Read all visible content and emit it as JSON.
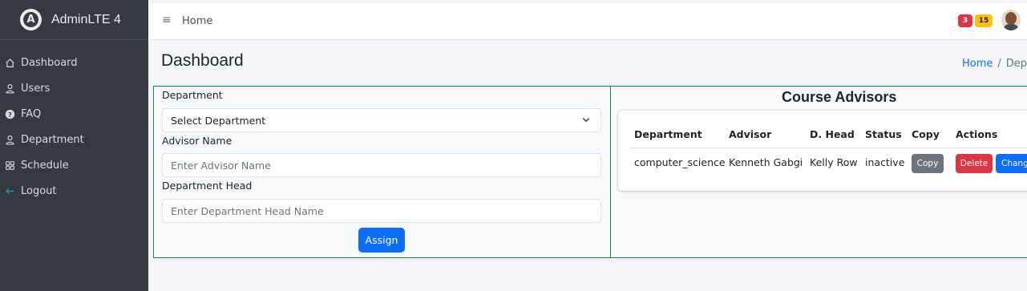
{
  "brand": {
    "name": "AdminLTE 4",
    "logo_letter": "A"
  },
  "sidebar": {
    "items": [
      {
        "label": "Dashboard",
        "icon": "house-icon"
      },
      {
        "label": "Users",
        "icon": "person-icon"
      },
      {
        "label": "FAQ",
        "icon": "question-circle-icon"
      },
      {
        "label": "Department",
        "icon": "person-icon"
      },
      {
        "label": "Schedule",
        "icon": "grid-icon"
      },
      {
        "label": "Logout",
        "icon": "arrow-left-icon"
      }
    ]
  },
  "topbar": {
    "menu_icon": "≡",
    "home_label": "Home",
    "badges": {
      "red": "3",
      "yellow": "15"
    },
    "colors": {
      "red": "#dc3545",
      "yellow": "#ffc107"
    }
  },
  "header": {
    "title": "Dashboard",
    "breadcrumb": {
      "home": "Home",
      "separator": "/",
      "current": "Depa"
    }
  },
  "form": {
    "department_label": "Department",
    "department_select": "Select Department",
    "advisor_label": "Advisor Name",
    "advisor_placeholder": "Enter Advisor Name",
    "head_label": "Department Head",
    "head_placeholder": "Enter Department Head Name",
    "assign_button": "Assign"
  },
  "table": {
    "title": "Course Advisors",
    "columns": [
      "Department",
      "Advisor",
      "D. Head",
      "Status",
      "Copy",
      "Actions"
    ],
    "rows": [
      {
        "department": "computer_science",
        "advisor": "Kenneth Gabgi",
        "head": "Kelly Row",
        "status": "inactive",
        "copy_button": "Copy",
        "delete_button": "Delete",
        "change_button": "Chang"
      }
    ]
  },
  "colors": {
    "accent": "#0d6efd",
    "border": "#198754",
    "sidebar": "#343a40"
  }
}
